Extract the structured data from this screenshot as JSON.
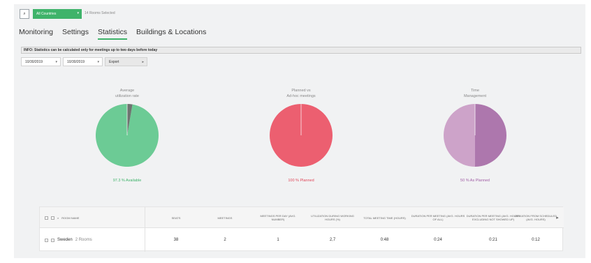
{
  "header": {
    "country_label": "All Countries",
    "rooms_selected": "14 Rooms Selected"
  },
  "tabs": [
    "Monitoring",
    "Settings",
    "Statistics",
    "Buildings & Locations"
  ],
  "active_tab": "Statistics",
  "info_text": "INFO: Statistics can be calculated only for meetings up to two days before today",
  "filters": {
    "date_from": "10/30/2019",
    "date_to": "10/30/2019",
    "export_label": "Export"
  },
  "chart_data": [
    {
      "type": "pie",
      "title": [
        "Average",
        "utilization rate"
      ],
      "slices": [
        {
          "label": "Available",
          "value": 97.3,
          "color": "#6ccb95"
        },
        {
          "label": "",
          "value": 2.7,
          "color": "#6e7470"
        }
      ],
      "legend": "97.3 % Available",
      "legend_color": "#3fb36a"
    },
    {
      "type": "pie",
      "title": [
        "Planned vs",
        "Ad-hoc meetings"
      ],
      "slices": [
        {
          "label": "Planned",
          "value": 100,
          "color": "#ec5f70"
        }
      ],
      "legend": "100 % Planned",
      "legend_color": "#e0485a"
    },
    {
      "type": "pie",
      "title": [
        "Time",
        "Management"
      ],
      "slices": [
        {
          "label": "As Planned",
          "value": 50,
          "color": "#cda3c9"
        },
        {
          "label": "",
          "value": 50,
          "color": "#ad77ad"
        }
      ],
      "legend": "50 % As Planned",
      "legend_color": "#a05ea5"
    }
  ],
  "table": {
    "headers": [
      "ROOM NAME",
      "SEATS",
      "MEETINGS",
      "MEETINGS PER DAY (AVG. NUMBER)",
      "UTILIZATION DURING WORKING HOURS (%)",
      "TOTAL MEETING TIME (HOURS)",
      "DURATION PER MEETING (AVG. HOURS OF ALL)",
      "DURATION PER MEETING (AVG. HOURS EXCLUDING NOT SHOWED UP)",
      "DEVIATION FROM SCHEDULED (AVG. HOURS)"
    ],
    "row": {
      "name": "Sweden",
      "count": "2 Rooms",
      "values": [
        "38",
        "2",
        "1",
        "2,7",
        "0:48",
        "0:24",
        "0:21",
        "0:12"
      ]
    }
  }
}
